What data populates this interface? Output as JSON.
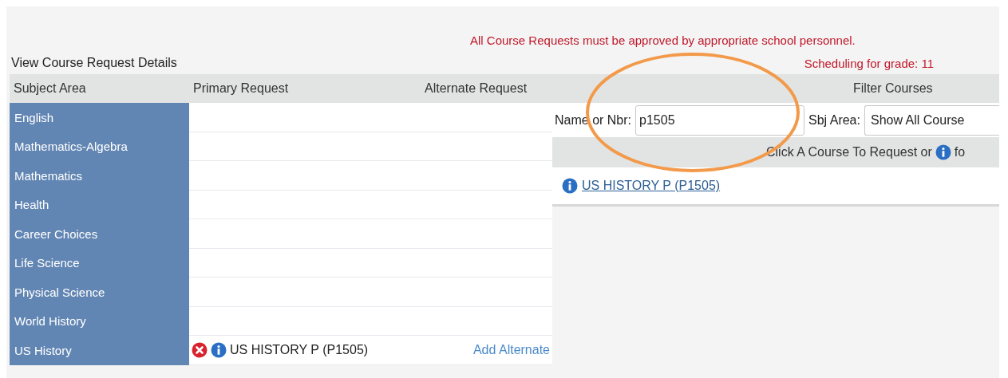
{
  "notices": [
    "All Course Requests must be approved by appropriate school personnel.",
    "Scheduling for grade: 11"
  ],
  "title": "View Course Request Details",
  "table": {
    "columns": [
      "Subject Area",
      "Primary Request",
      "Alternate Request"
    ],
    "rows": [
      {
        "subject": "English"
      },
      {
        "subject": "Mathematics-Algebra"
      },
      {
        "subject": "Mathematics"
      },
      {
        "subject": "Health"
      },
      {
        "subject": "Career Choices"
      },
      {
        "subject": "Life Science"
      },
      {
        "subject": "Physical Science"
      },
      {
        "subject": "World History"
      },
      {
        "subject": "US History",
        "primary": "US HISTORY P (P1505)",
        "alternate_link": "Add Alternate"
      }
    ]
  },
  "filter": {
    "title": "Filter Courses",
    "name_label": "Name or Nbr:",
    "name_value": "p1505",
    "area_label": "Sbj Area:",
    "area_value": "Show All Course",
    "hint_before": "Click A Course To Request or",
    "hint_after": "fo",
    "results": [
      "US HISTORY P (P1505)"
    ]
  }
}
